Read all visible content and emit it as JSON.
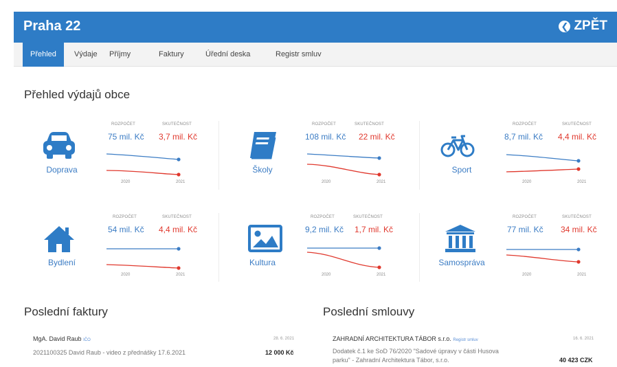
{
  "app": {
    "title": "Praha 22",
    "back_label": "ZPĚT"
  },
  "tabs": [
    {
      "label": "Přehled",
      "active": true
    },
    {
      "label": "Výdaje"
    },
    {
      "label": "Příjmy"
    },
    {
      "label": "Faktury"
    },
    {
      "label": "Úřední deska"
    },
    {
      "label": "Registr smluv"
    }
  ],
  "overview": {
    "title": "Přehled výdajů obce",
    "col_budget": "ROZPOČET",
    "col_actual": "SKUTEČNOST",
    "cards": [
      {
        "name": "Doprava",
        "icon": "car-icon",
        "budget": "75 mil. Kč",
        "actual": "3,7 mil. Kč",
        "year_from": "2020",
        "year_to": "2021"
      },
      {
        "name": "Školy",
        "icon": "book-icon",
        "budget": "108 mil. Kč",
        "actual": "22 mil. Kč",
        "year_from": "2020",
        "year_to": "2021"
      },
      {
        "name": "Sport",
        "icon": "bicycle-icon",
        "budget": "8,7 mil. Kč",
        "actual": "4,4 mil. Kč",
        "year_from": "2020",
        "year_to": "2021"
      },
      {
        "name": "Bydlení",
        "icon": "house-icon",
        "budget": "54 mil. Kč",
        "actual": "4,4 mil. Kč",
        "year_from": "2020",
        "year_to": "2021"
      },
      {
        "name": "Kultura",
        "icon": "picture-icon",
        "budget": "9,2 mil. Kč",
        "actual": "1,7 mil. Kč",
        "year_from": "2020",
        "year_to": "2021"
      },
      {
        "name": "Samospráva",
        "icon": "institution-icon",
        "budget": "77 mil. Kč",
        "actual": "34 mil. Kč",
        "year_from": "2020",
        "year_to": "2021"
      }
    ]
  },
  "invoices": {
    "title": "Poslední faktury",
    "items": [
      {
        "name": "MgA. David Raub",
        "tag": "IČO",
        "date": "28. 6. 2021",
        "desc": "2021100325 David Raub - video z přednášky 17.6.2021",
        "amount": "12 000 Kč"
      }
    ]
  },
  "contracts": {
    "title": "Poslední smlouvy",
    "items": [
      {
        "name": "ZAHRADNÍ ARCHITEKTURA TÁBOR s.r.o.",
        "tag": "Registr smluv",
        "date": "16. 6. 2021",
        "desc1": "Dodatek č.1 ke SoD 76/2020 \"Sadové úpravy v části Husova",
        "desc2": "parku\" - Zahradní Architektura Tábor, s.r.o.",
        "amount": "40 423 CZK"
      }
    ]
  },
  "colors": {
    "primary": "#2e7cc6",
    "budget": "#3b7cc4",
    "actual": "#e0382d"
  }
}
